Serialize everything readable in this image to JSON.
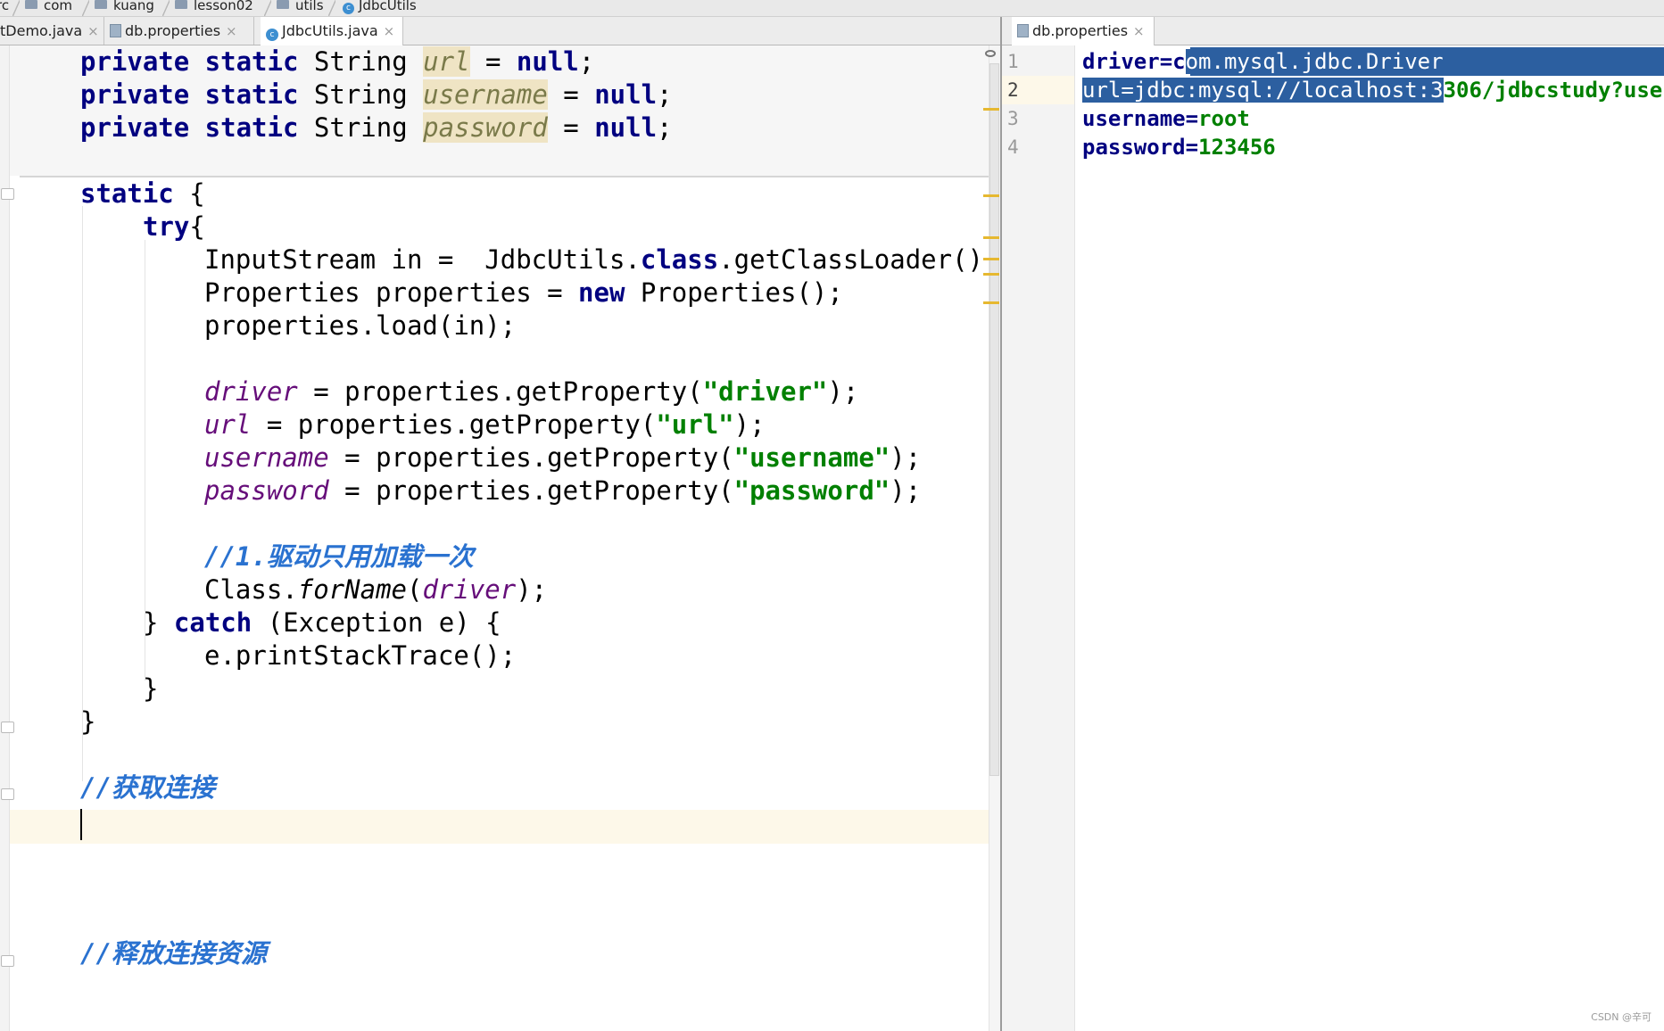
{
  "breadcrumb": [
    {
      "label": "rc",
      "icon": "folder-icon"
    },
    {
      "label": "com",
      "icon": "folder-icon"
    },
    {
      "label": "kuang",
      "icon": "folder-icon"
    },
    {
      "label": "lesson02",
      "icon": "folder-icon"
    },
    {
      "label": "utils",
      "icon": "folder-icon"
    },
    {
      "label": "JdbcUtils",
      "icon": "class-icon"
    }
  ],
  "left_tabs": [
    {
      "label": "tDemo.java"
    },
    {
      "label": "db.properties"
    },
    {
      "label": "JdbcUtils.java",
      "active": true
    }
  ],
  "right_tabs": [
    {
      "label": "db.properties",
      "active": true
    }
  ],
  "code": {
    "l1": {
      "kw": "private static",
      "type": " String ",
      "field": "url",
      "rest": " = ",
      "val": "null",
      "end": ";"
    },
    "l2": {
      "kw": "private static",
      "type": " String ",
      "field": "username",
      "rest": " = ",
      "val": "null",
      "end": ";"
    },
    "l3": {
      "kw": "private static",
      "type": " String ",
      "field": "password",
      "rest": " = ",
      "val": "null",
      "end": ";"
    },
    "static_kw": "static",
    "static_brace": " {",
    "try_kw": "try",
    "try_brace": "{",
    "in_a": "InputStream in =  JdbcUtils.",
    "in_kw": "class",
    "in_b": ".getClassLoader().g",
    "props_a": "Properties properties = ",
    "props_kw": "new",
    "props_b": " Properties();",
    "load": "properties.load(in);",
    "driver_f": "driver",
    "driver_m": " = properties.getProperty(",
    "driver_s": "\"driver\"",
    "driver_e": ");",
    "url_f": "url",
    "url_m": " = properties.getProperty(",
    "url_s": "\"url\"",
    "url_e": ");",
    "user_f": "username",
    "user_m": " = properties.getProperty(",
    "user_s": "\"username\"",
    "user_e": ");",
    "pass_f": "password",
    "pass_m": " = properties.getProperty(",
    "pass_s": "\"password\"",
    "pass_e": ");",
    "comment1": "//1.驱动只用加载一次",
    "forname_a": "Class.",
    "forname_m": "forName",
    "forname_b": "(",
    "forname_f": "driver",
    "forname_c": ");",
    "catch_a": "} ",
    "catch_kw": "catch",
    "catch_b": " (Exception e) {",
    "trace": "e.printStackTrace();",
    "close_try": "}",
    "close_static": "}",
    "comment2": "//获取连接",
    "comment3": "//释放连接资源"
  },
  "properties_file": {
    "line_numbers": [
      "1",
      "2",
      "3",
      "4"
    ],
    "l1_key_a": "driver=c",
    "l1_sel": "om.mysql.jdbc.Driver",
    "l2_sel": "url=jdbc:mysql://localhost:3",
    "l2_rest": "306/jdbcstudy?use",
    "l3_key": "username=",
    "l3_val": "root",
    "l4_key": "password=",
    "l4_val": "123456"
  },
  "watermark": "CSDN @辛可",
  "colors": {
    "keyword": "#000080",
    "field": "#660e7a",
    "string": "#008000",
    "comment": "#2a72d0",
    "selection": "#2c5fa0",
    "caret_row": "#fdf8e9"
  }
}
